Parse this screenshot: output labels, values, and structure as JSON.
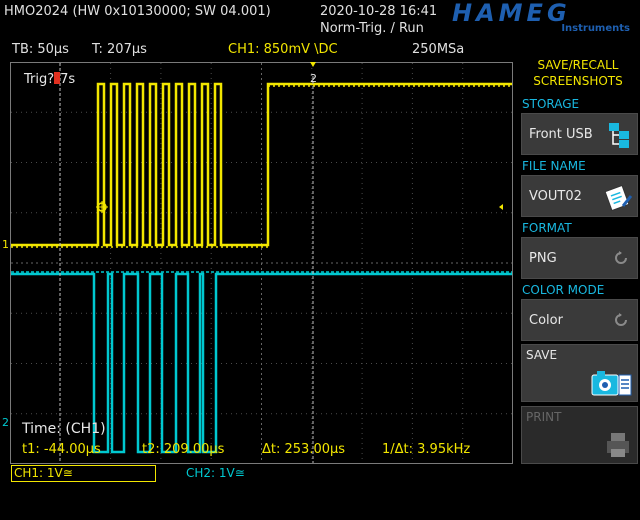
{
  "header": {
    "device": "HMO2024 (HW 0x10130000; SW 04.001)",
    "datetime": "2020-10-28 16:41",
    "trigger_status": "Norm-Trig. / Run",
    "brand": "HAMEG",
    "brand_sub": "Instruments"
  },
  "status_bar": {
    "timebase": "TB: 50µs",
    "trigger_time": "T: 207µs",
    "ch1_setting": "CH1: 850mV \\DC",
    "sample_rate": "250MSa"
  },
  "scope": {
    "trig_label": "Trig?",
    "trig_value": "7s",
    "cursor2_label": "2",
    "ch1_marker": "1",
    "ch2_marker": "2",
    "time_label": "Time: (CH1)"
  },
  "cursors": {
    "t1": "t1: -44.00µs",
    "t2": "t2: 209.00µs",
    "dt": "Δt: 253.00µs",
    "inv_dt": "1/Δt: 3.95kHz"
  },
  "channels": {
    "ch1": "CH1: 1V≅",
    "ch2": "CH2: 1V≅"
  },
  "menu": {
    "title_line1": "SAVE/RECALL",
    "title_line2": "SCREENSHOTS",
    "storage_label": "STORAGE",
    "storage_value": "Front USB",
    "filename_label": "FILE NAME",
    "filename_value": "VOUT02",
    "format_label": "FORMAT",
    "format_value": "PNG",
    "colormode_label": "COLOR MODE",
    "colormode_value": "Color",
    "save_label": "SAVE",
    "print_label": "PRINT"
  },
  "colors": {
    "ch1": "#f2e600",
    "ch2": "#00c8d0",
    "accent": "#19b8e0",
    "grid": "#4a4a4a"
  }
}
